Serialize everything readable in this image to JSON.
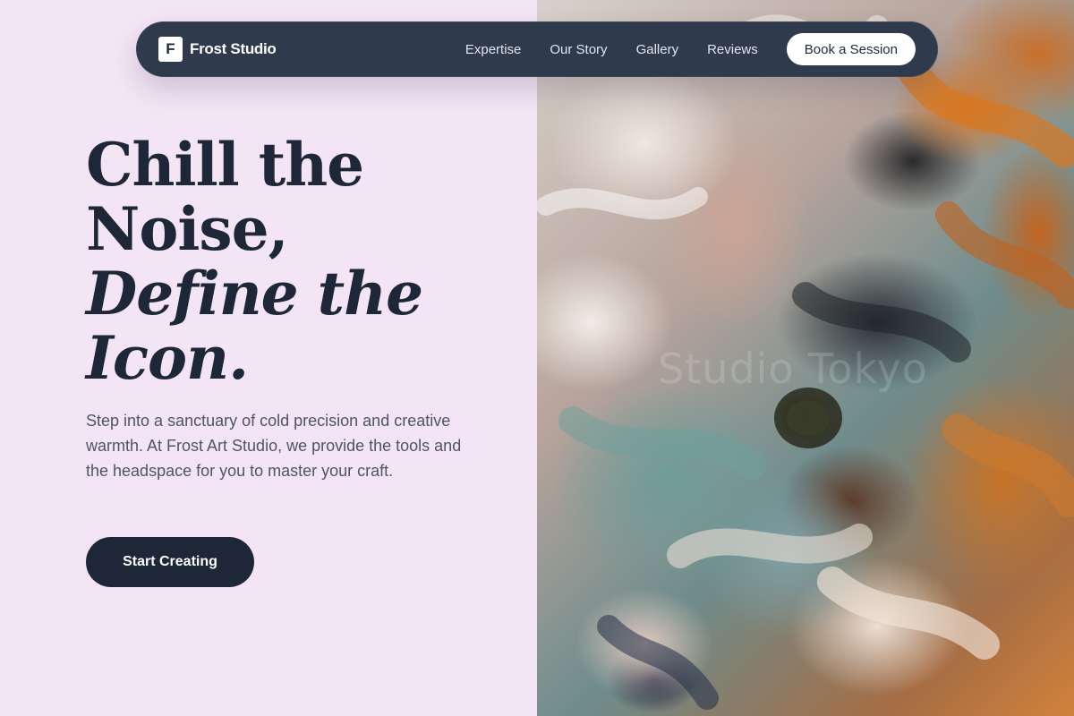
{
  "nav": {
    "logo_letter": "F",
    "brand": "Frost Studio",
    "links": [
      "Expertise",
      "Our Story",
      "Gallery",
      "Reviews"
    ],
    "cta": "Book a Session"
  },
  "hero": {
    "title_line1": "Chill the",
    "title_line2": "Noise,",
    "title_line3": "Define the",
    "title_line4": "Icon.",
    "description": "Step into a sanctuary of cold precision and creative warmth. At Frost Art Studio, we provide the tools and the headspace for you to master your craft.",
    "button": "Start Creating"
  },
  "image": {
    "watermark": "Studio Tokyo"
  },
  "colors": {
    "background": "#f3e5f5",
    "navbar": "#2f3a4c",
    "dark_text": "#1e2738",
    "body_text": "#4e5566"
  }
}
